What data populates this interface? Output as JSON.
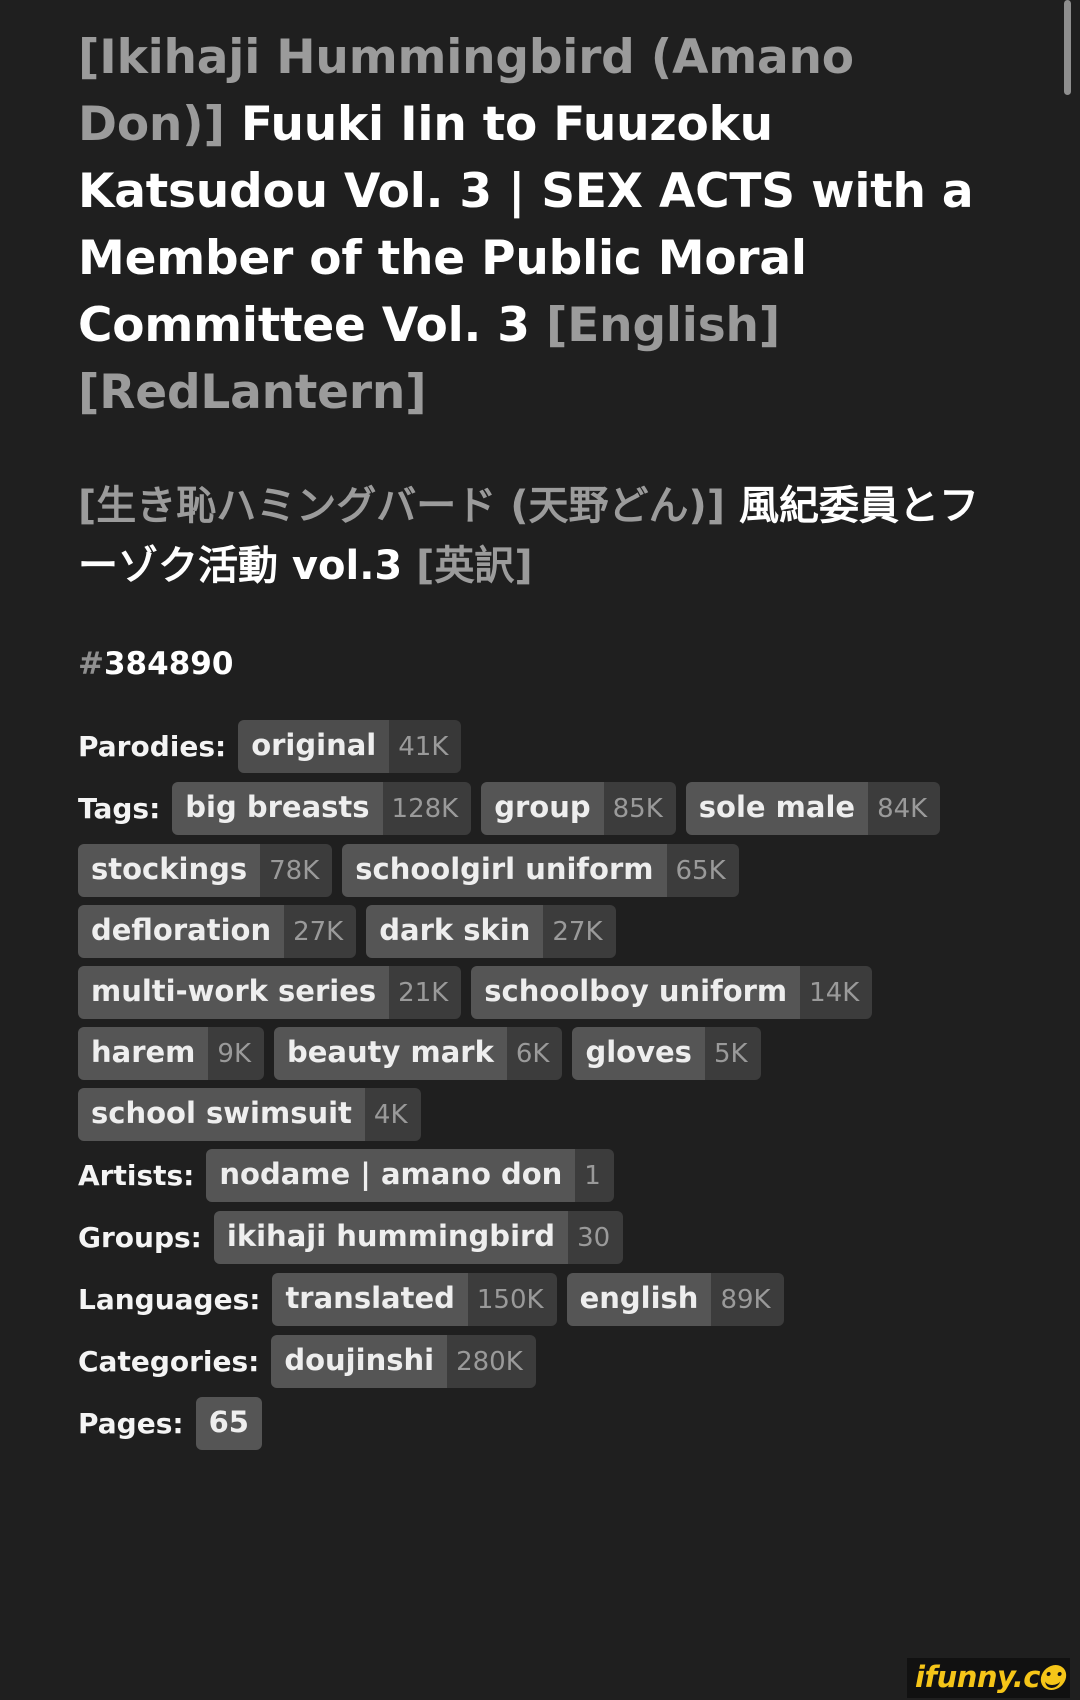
{
  "title": {
    "artist_prefix": "[Ikihaji Hummingbird (Amano Don)]",
    "main": "Fuuki Iin to Fuuzoku Katsudou Vol. 3 | SEX ACTS with a Member of the Public Moral Committee Vol. 3",
    "language_tag": "[English]",
    "scanlator_tag": "[RedLantern]"
  },
  "subtitle": {
    "artist_prefix": "[生き恥ハミングバード (天野どん)]",
    "main": "風紀委員とフーゾク活動 vol.3",
    "language_tag": "[英訳]"
  },
  "gallery_id": {
    "hash": "#",
    "number": "384890"
  },
  "metadata_rows": [
    {
      "label": "Parodies:",
      "style": "muted",
      "pills": [
        {
          "name": "original",
          "count": "41K"
        }
      ]
    },
    {
      "label": "Tags:",
      "style": "normal",
      "pills": [
        {
          "name": "big breasts",
          "count": "128K"
        },
        {
          "name": "group",
          "count": "85K"
        },
        {
          "name": "sole male",
          "count": "84K"
        },
        {
          "name": "stockings",
          "count": "78K"
        },
        {
          "name": "schoolgirl uniform",
          "count": "65K"
        },
        {
          "name": "defloration",
          "count": "27K"
        },
        {
          "name": "dark skin",
          "count": "27K"
        },
        {
          "name": "multi-work series",
          "count": "21K"
        },
        {
          "name": "schoolboy uniform",
          "count": "14K"
        },
        {
          "name": "harem",
          "count": "9K"
        },
        {
          "name": "beauty mark",
          "count": "6K"
        },
        {
          "name": "gloves",
          "count": "5K"
        },
        {
          "name": "school swimsuit",
          "count": "4K"
        }
      ]
    },
    {
      "label": "Artists:",
      "style": "normal",
      "pills": [
        {
          "name": "nodame | amano don",
          "count": "1"
        }
      ]
    },
    {
      "label": "Groups:",
      "style": "normal",
      "pills": [
        {
          "name": "ikihaji hummingbird",
          "count": "30"
        }
      ]
    },
    {
      "label": "Languages:",
      "style": "normal",
      "pills": [
        {
          "name": "translated",
          "count": "150K"
        },
        {
          "name": "english",
          "count": "89K"
        }
      ]
    },
    {
      "label": "Categories:",
      "style": "normal",
      "pills": [
        {
          "name": "doujinshi",
          "count": "280K"
        }
      ]
    },
    {
      "label": "Pages:",
      "style": "normal",
      "pills": [
        {
          "name": "65",
          "count": ""
        }
      ]
    }
  ],
  "watermark": {
    "text": "ifunny.c"
  },
  "colors": {
    "background": "#1f1f1f",
    "title_text": "#ffffff",
    "dim_text": "#9b9b9b",
    "pill_name_bg": "#555555",
    "pill_count_bg": "#3c3c3c",
    "watermark": "#f5c518",
    "scrollbar": "#8e8e8e"
  }
}
